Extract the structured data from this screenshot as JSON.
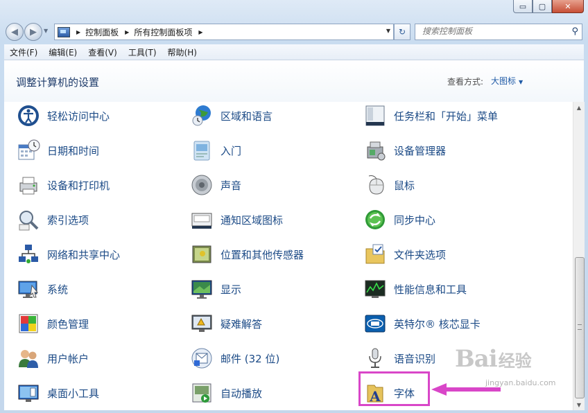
{
  "window": {
    "caption_min": "▭",
    "caption_max": "▢",
    "caption_close": "✕"
  },
  "nav": {
    "back_glyph": "◀",
    "forward_glyph": "▶",
    "breadcrumbs": [
      "控制面板",
      "所有控制面板项"
    ],
    "refresh_glyph": "↻",
    "search_placeholder": "搜索控制面板"
  },
  "menu": {
    "items": [
      "文件(F)",
      "编辑(E)",
      "查看(V)",
      "工具(T)",
      "帮助(H)"
    ]
  },
  "header": {
    "title": "调整计算机的设置",
    "view_label": "查看方式:",
    "view_value": "大图标"
  },
  "items": [
    {
      "label": "轻松访问中心",
      "icon": "ease-of-access-icon"
    },
    {
      "label": "区域和语言",
      "icon": "region-language-icon"
    },
    {
      "label": "任务栏和「开始」菜单",
      "icon": "taskbar-icon"
    },
    {
      "label": "日期和时间",
      "icon": "date-time-icon"
    },
    {
      "label": "入门",
      "icon": "getting-started-icon"
    },
    {
      "label": "设备管理器",
      "icon": "device-manager-icon"
    },
    {
      "label": "设备和打印机",
      "icon": "printer-icon"
    },
    {
      "label": "声音",
      "icon": "sound-icon"
    },
    {
      "label": "鼠标",
      "icon": "mouse-icon"
    },
    {
      "label": "索引选项",
      "icon": "indexing-icon"
    },
    {
      "label": "通知区域图标",
      "icon": "notification-area-icon"
    },
    {
      "label": "同步中心",
      "icon": "sync-center-icon"
    },
    {
      "label": "网络和共享中心",
      "icon": "network-icon"
    },
    {
      "label": "位置和其他传感器",
      "icon": "location-sensor-icon"
    },
    {
      "label": "文件夹选项",
      "icon": "folder-options-icon"
    },
    {
      "label": "系统",
      "icon": "system-icon"
    },
    {
      "label": "显示",
      "icon": "display-icon"
    },
    {
      "label": "性能信息和工具",
      "icon": "performance-icon"
    },
    {
      "label": "颜色管理",
      "icon": "color-management-icon"
    },
    {
      "label": "疑难解答",
      "icon": "troubleshooting-icon"
    },
    {
      "label": "英特尔® 核芯显卡",
      "icon": "intel-graphics-icon"
    },
    {
      "label": "用户帐户",
      "icon": "user-accounts-icon"
    },
    {
      "label": "邮件 (32 位)",
      "icon": "mail-icon"
    },
    {
      "label": "语音识别",
      "icon": "microphone-icon"
    },
    {
      "label": "桌面小工具",
      "icon": "gadgets-icon"
    },
    {
      "label": "自动播放",
      "icon": "autoplay-icon"
    },
    {
      "label": "字体",
      "icon": "fonts-icon"
    }
  ],
  "watermark": {
    "brand": "Bai",
    "brand2": "经验",
    "url": "jingyan.baidu.com"
  },
  "colors": {
    "link": "#1b4a86",
    "highlight": "#d946c8"
  }
}
